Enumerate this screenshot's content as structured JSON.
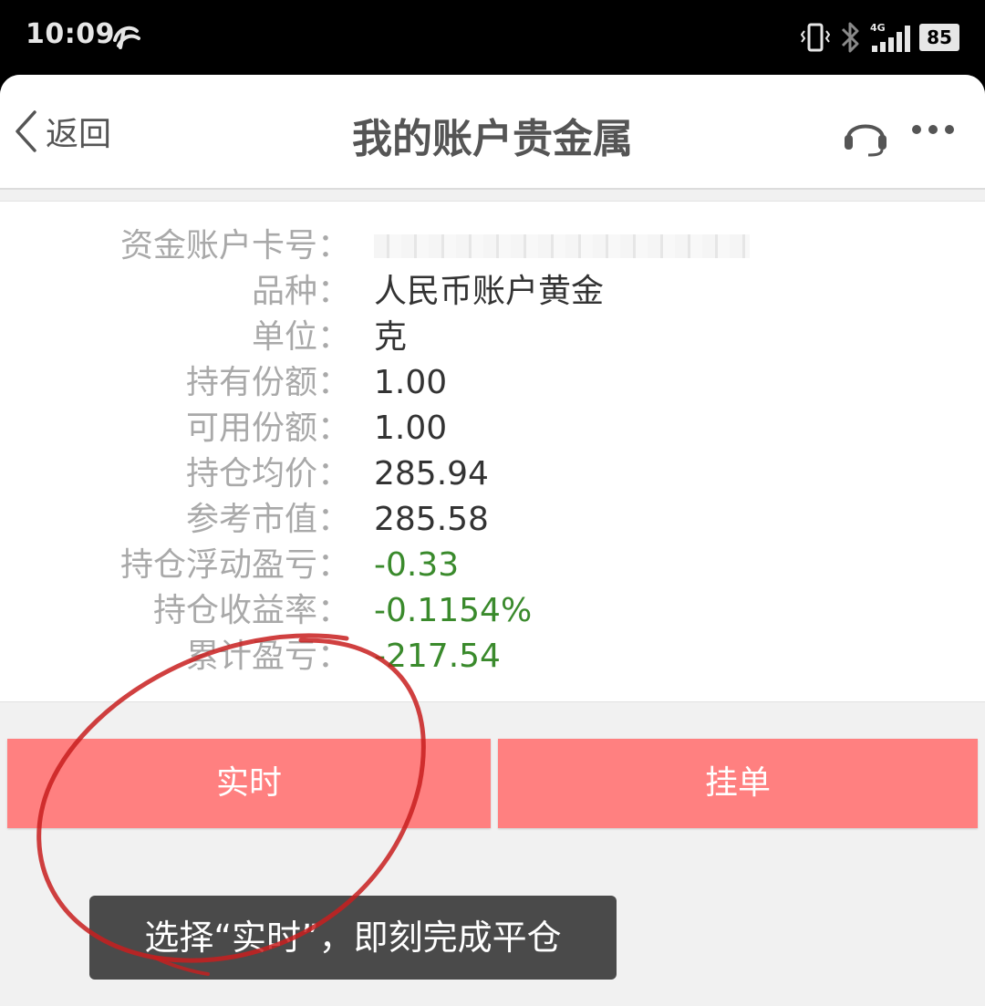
{
  "status_bar": {
    "time": "10:09",
    "network": "4G",
    "battery": "85"
  },
  "header": {
    "back_label": "返回",
    "title": "我的账户贵金属"
  },
  "account": {
    "rows": [
      {
        "label": "资金账户卡号：",
        "value": ""
      },
      {
        "label": "品种：",
        "value": "人民币账户黄金"
      },
      {
        "label": "单位：",
        "value": "克"
      },
      {
        "label": "持有份额：",
        "value": "1.00"
      },
      {
        "label": "可用份额：",
        "value": "1.00"
      },
      {
        "label": "持仓均价：",
        "value": "285.94"
      },
      {
        "label": "参考市值：",
        "value": "285.58"
      },
      {
        "label": "持仓浮动盈亏：",
        "value": "-0.33"
      },
      {
        "label": "持仓收益率：",
        "value": "-0.1154%"
      },
      {
        "label": "累计盈亏：",
        "value": "-217.54"
      }
    ]
  },
  "actions": {
    "realtime_label": "实时",
    "order_label": "挂单"
  },
  "toast": {
    "message": "选择“实时”，即刻完成平仓"
  },
  "colors": {
    "button": "#ff8080",
    "negative_value": "#3a8a2c",
    "annotation": "#c81e1e"
  }
}
